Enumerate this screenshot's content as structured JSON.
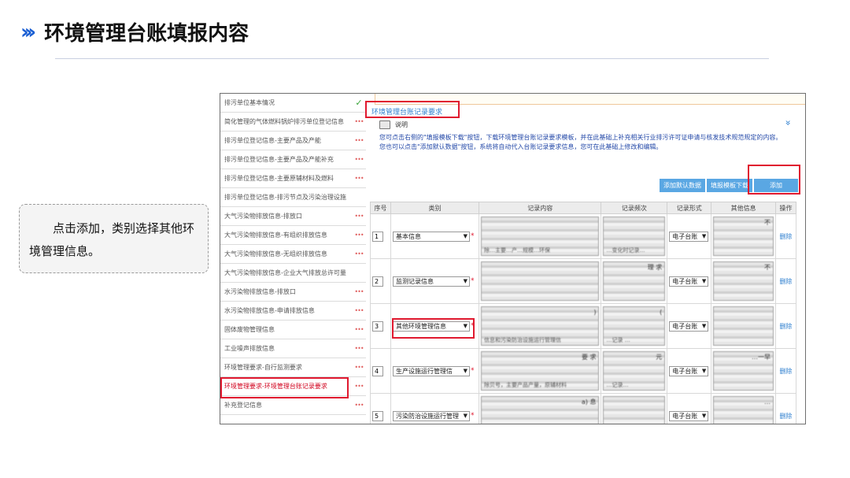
{
  "header": {
    "chevrons": "›››",
    "title": "环境管理台账填报内容"
  },
  "note": {
    "text": "点击添加，类别选择其他环境管理信息。"
  },
  "sidebar": {
    "items": [
      {
        "label": "排污单位基本情况",
        "status": "✓"
      },
      {
        "label": "简化管理的气体燃料锅炉排污单位登记信息",
        "status": "•••"
      },
      {
        "label": "排污单位登记信息-主要产品及产能",
        "status": "•••"
      },
      {
        "label": "排污单位登记信息-主要产品及产能补充",
        "status": "•••"
      },
      {
        "label": "排污单位登记信息-主要原辅材料及燃料",
        "status": "•••"
      },
      {
        "label": "排污单位登记信息-排污节点及污染治理设施",
        "status": ""
      },
      {
        "label": "大气污染物排放信息-排放口",
        "status": "•••"
      },
      {
        "label": "大气污染物排放信息-有组织排放信息",
        "status": "•••"
      },
      {
        "label": "大气污染物排放信息-无组织排放信息",
        "status": "•••"
      },
      {
        "label": "大气污染物排放信息-企业大气排放总许可量",
        "status": ""
      },
      {
        "label": "水污染物排放信息-排放口",
        "status": "•••"
      },
      {
        "label": "水污染物排放信息-申请排放信息",
        "status": "•••"
      },
      {
        "label": "固体废物管理信息",
        "status": "•••"
      },
      {
        "label": "工业噪声排放信息",
        "status": "•••"
      },
      {
        "label": "环境管理要求-自行监测要求",
        "status": "•••"
      },
      {
        "label": "环境管理要求-环境管理台账记录要求",
        "status": "•••"
      },
      {
        "label": "补充登记信息",
        "status": "•••"
      }
    ]
  },
  "main": {
    "section_title": "环境管理台账记录要求",
    "help_label": "说明",
    "desc_line1": "您可点击右侧的\"填报模板下载\"按钮，下载环境管理台账记录要求模板，并在此基础上补充相关行业排污许可证申请与核发技术规范规定的内容。",
    "desc_line2": "您也可以点击\"添加默认数据\"按钮，系统将自动代入台账记录要求信息，您可在此基础上修改和编辑。",
    "buttons": {
      "default_data": "添加默认数据",
      "template_download": "填报模板下载",
      "add": "添加"
    },
    "columns": [
      "序号",
      "类别",
      "记录内容",
      "记录频次",
      "记录形式",
      "其他信息",
      "操作"
    ],
    "rows": [
      {
        "seq": "1",
        "category": "基本信息",
        "content_frag": "",
        "content_bottom": "除…主要…产…规模…环保",
        "freq_frag": "",
        "freq_bottom": "…变化时记录…",
        "form": "电子台账",
        "other_frag": "不",
        "action": "删除"
      },
      {
        "seq": "2",
        "category": "监测记录信息",
        "content_frag": "",
        "content_bottom": "",
        "freq_frag": "理\n求",
        "freq_bottom": "",
        "form": "电子台账",
        "other_frag": "不",
        "action": "删除"
      },
      {
        "seq": "3",
        "category": "其他环境管理信息",
        "content_frag": "\n)",
        "content_bottom": "信息和污染防治设施运行管理信",
        "freq_frag": "(",
        "freq_bottom": "…记录 …",
        "form": "电子台账",
        "other_frag": "",
        "action": "删除"
      },
      {
        "seq": "4",
        "category": "生产设施运行管理信",
        "content_frag": "要\n求",
        "content_bottom": "除贝号，主要产品产量，原辅材料",
        "freq_frag": "元",
        "freq_bottom": "…记录…",
        "form": "电子台账",
        "other_frag": "…一早",
        "action": "删除"
      },
      {
        "seq": "5",
        "category": "污染防治设施运行管理",
        "content_frag": "a)\n息",
        "content_bottom": "",
        "freq_frag": "",
        "freq_bottom": "运行状态…按照",
        "form": "电子台账",
        "other_frag": "…",
        "action": "删除"
      }
    ]
  }
}
